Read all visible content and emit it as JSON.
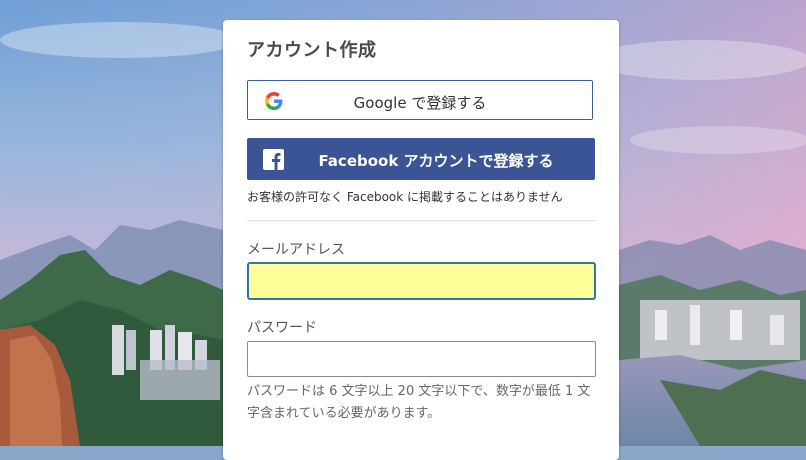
{
  "form": {
    "title": "アカウント作成",
    "google_button_label": "Google で登録する",
    "facebook_button_label": "Facebook アカウントで登録する",
    "facebook_note": "お客様の許可なく Facebook に掲載することはありません",
    "email_label": "メールアドレス",
    "email_value": "",
    "password_label": "パスワード",
    "password_value": "",
    "password_hint": "パスワードは 6 文字以上 20 文字以下で、数字が最低 1 文字含まれている必要があります。"
  },
  "icons": {
    "google": "google-g-icon",
    "facebook": "facebook-f-icon"
  },
  "colors": {
    "facebook_blue": "#3b5496",
    "email_input_bg": "#ffff99",
    "email_input_border": "#2f76a7",
    "google_button_border": "#3b5aa8"
  }
}
